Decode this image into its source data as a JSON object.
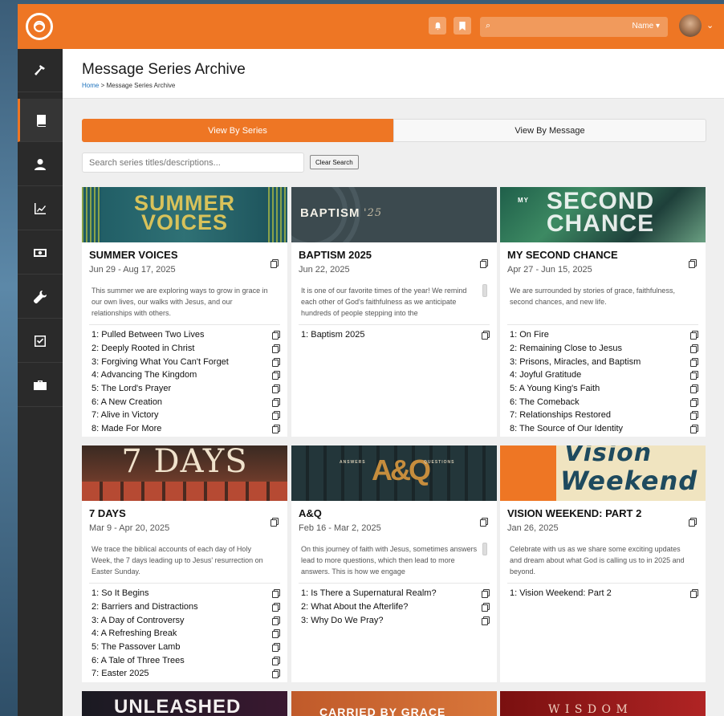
{
  "header": {
    "name_menu": "Name ▾"
  },
  "page": {
    "title": "Message Series Archive",
    "breadcrumb_home": "Home",
    "breadcrumb_sep": ">",
    "breadcrumb_current": "Message Series Archive"
  },
  "tabs": {
    "series": "View By Series",
    "message": "View By Message"
  },
  "search": {
    "placeholder": "Search series titles/descriptions...",
    "clear_label": "Clear Search"
  },
  "cards": [
    {
      "title": "SUMMER VOICES",
      "dates": "Jun 29 - Aug 17, 2025",
      "banner_text": "SUMMER VOICES",
      "desc": "This summer we are exploring ways to grow in grace in our own lives, our walks with Jesus, and our relationships with others.",
      "messages": [
        "1: Pulled Between Two Lives",
        "2: Deeply Rooted in Christ",
        "3: Forgiving What You Can't Forget",
        "4: Advancing The Kingdom",
        "5: The Lord's Prayer",
        "6: A New Creation",
        "7: Alive in Victory",
        "8: Made For More"
      ]
    },
    {
      "title": "BAPTISM 2025",
      "dates": "Jun 22, 2025",
      "banner_text": "BAPTISM",
      "banner_sub": "'25",
      "desc": "It is one of our favorite times of the year! We remind each other of God's faithfulness as we anticipate hundreds of people stepping into the",
      "messages": [
        "1: Baptism 2025"
      ]
    },
    {
      "title": "MY SECOND CHANCE",
      "dates": "Apr 27 - Jun 15, 2025",
      "banner_text": "SECOND CHANCE",
      "banner_small": "MY",
      "desc": "We are surrounded by stories of grace, faithfulness, second chances, and new life.",
      "messages": [
        "1: On Fire",
        "2: Remaining Close to Jesus",
        "3: Prisons, Miracles, and Baptism",
        "4: Joyful Gratitude",
        "5: A Young King's Faith",
        "6: The Comeback",
        "7: Relationships Restored",
        "8: The Source of Our Identity"
      ]
    },
    {
      "title": "7 DAYS",
      "dates": "Mar 9 - Apr 20, 2025",
      "banner_text": "7 DAYS",
      "desc": "We trace the biblical accounts of each day of Holy Week, the 7 days leading up to Jesus' resurrection on Easter Sunday.",
      "messages": [
        "1: So It Begins",
        "2: Barriers and Distractions",
        "3: A Day of Controversy",
        "4: A Refreshing Break",
        "5: The Passover Lamb",
        "6: A Tale of Three Trees",
        "7: Easter 2025"
      ]
    },
    {
      "title": "A&Q",
      "dates": "Feb 16 - Mar 2, 2025",
      "banner_text": "A&Q",
      "banner_left": "ANSWERS",
      "banner_right": "QUESTIONS",
      "desc": "On this journey of faith with Jesus, sometimes answers lead to more questions, which then lead to more answers. This is how we engage",
      "messages": [
        "1: Is There a Supernatural Realm?",
        "2: What About the Afterlife?",
        "3: Why Do We Pray?"
      ]
    },
    {
      "title": "VISION WEEKEND: PART 2",
      "dates": "Jan 26, 2025",
      "banner_text": "Vision",
      "banner_text2": "Weekend",
      "desc": "Celebrate with us as we share some exciting updates and dream about what God is calling us to in 2025 and beyond.",
      "messages": [
        "1: Vision Weekend: Part 2"
      ]
    },
    {
      "banner_text": "UNLEASHED"
    },
    {
      "banner_text": "CARRIED BY GRACE"
    },
    {
      "banner_text": "W I S D O M"
    }
  ],
  "colors": {
    "accent": "#ee7624",
    "sidebar": "#2a2a2a"
  }
}
